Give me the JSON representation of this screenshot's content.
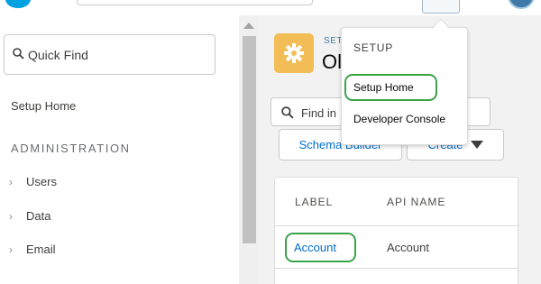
{
  "colors": {
    "brand_blue": "#00a1e0",
    "setup_icon_orange": "#f2bd54",
    "link_blue": "#006dcc",
    "highlight_green": "#3aa34a"
  },
  "sidebar": {
    "quick_find_placeholder": "Quick Find",
    "setup_home": "Setup Home",
    "section_heading": "ADMINISTRATION",
    "items": [
      {
        "label": "Users",
        "icon": "chevron-right-icon"
      },
      {
        "label": "Data",
        "icon": "chevron-right-icon"
      },
      {
        "label": "Email",
        "icon": "chevron-right-icon"
      }
    ]
  },
  "main": {
    "kicker": "SET",
    "title": "Ol",
    "find_placeholder": "Find in",
    "schema_builder_label": "Schema Builder",
    "create_label": "Create",
    "table": {
      "columns": [
        "LABEL",
        "API NAME"
      ],
      "rows": [
        {
          "label": "Account",
          "api_name": "Account"
        }
      ]
    }
  },
  "setup_menu": {
    "heading": "SETUP",
    "items": [
      "Setup Home",
      "Developer Console"
    ]
  }
}
